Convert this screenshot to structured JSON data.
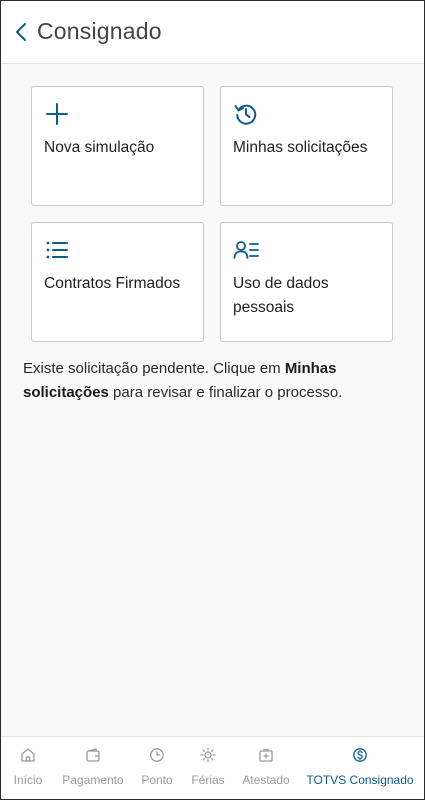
{
  "header": {
    "title": "Consignado",
    "back_icon": "chevron-left-icon"
  },
  "accent_color": "#0c5e8a",
  "cards": [
    {
      "label": "Nova simulação",
      "icon": "plus-icon"
    },
    {
      "label": "Minhas solicitações",
      "icon": "history-icon"
    },
    {
      "label": "Contratos Firmados",
      "icon": "list-icon"
    },
    {
      "label": "Uso de dados pessoais",
      "icon": "user-list-icon"
    }
  ],
  "message": {
    "part1": "Existe solicitação pendente. Clique em ",
    "bold": "Minhas solicitações",
    "part2": " para revisar e finalizar o processo."
  },
  "nav": [
    {
      "label": "Início",
      "icon": "home-icon",
      "active": false
    },
    {
      "label": "Pagamento",
      "icon": "wallet-icon",
      "active": false
    },
    {
      "label": "Ponto",
      "icon": "clock-icon",
      "active": false
    },
    {
      "label": "Férias",
      "icon": "sun-icon",
      "active": false
    },
    {
      "label": "Atestado",
      "icon": "medical-icon",
      "active": false
    },
    {
      "label": "TOTVS Consignado",
      "icon": "dollar-icon",
      "active": true
    }
  ]
}
